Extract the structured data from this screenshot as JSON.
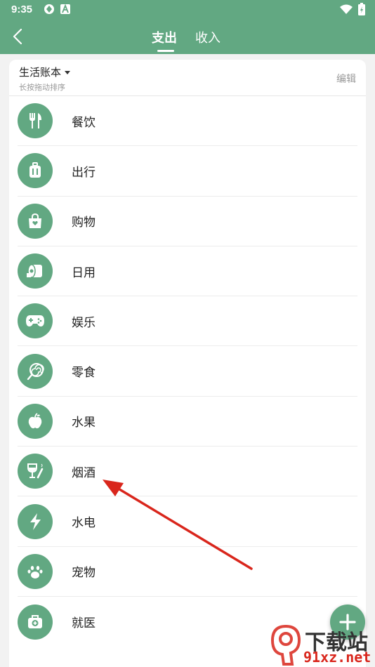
{
  "status": {
    "time": "9:35"
  },
  "header": {
    "tabs": [
      {
        "label": "支出",
        "active": true
      },
      {
        "label": "收入",
        "active": false
      }
    ]
  },
  "book": {
    "title": "生活账本",
    "subtitle": "长按拖动排序",
    "edit_label": "编辑"
  },
  "categories": [
    {
      "label": "餐饮",
      "icon": "utensils-icon"
    },
    {
      "label": "出行",
      "icon": "luggage-icon"
    },
    {
      "label": "购物",
      "icon": "shopping-bag-icon"
    },
    {
      "label": "日用",
      "icon": "toilet-paper-icon"
    },
    {
      "label": "娱乐",
      "icon": "gamepad-icon"
    },
    {
      "label": "零食",
      "icon": "lollipop-icon"
    },
    {
      "label": "水果",
      "icon": "apple-icon"
    },
    {
      "label": "烟酒",
      "icon": "wine-cigarette-icon"
    },
    {
      "label": "水电",
      "icon": "lightning-icon"
    },
    {
      "label": "宠物",
      "icon": "paw-icon"
    },
    {
      "label": "就医",
      "icon": "medical-kit-icon"
    }
  ],
  "watermark": {
    "top": "下载站",
    "bottom": "91xz.net"
  },
  "colors": {
    "primary": "#62a882",
    "arrow": "#d9261c"
  }
}
